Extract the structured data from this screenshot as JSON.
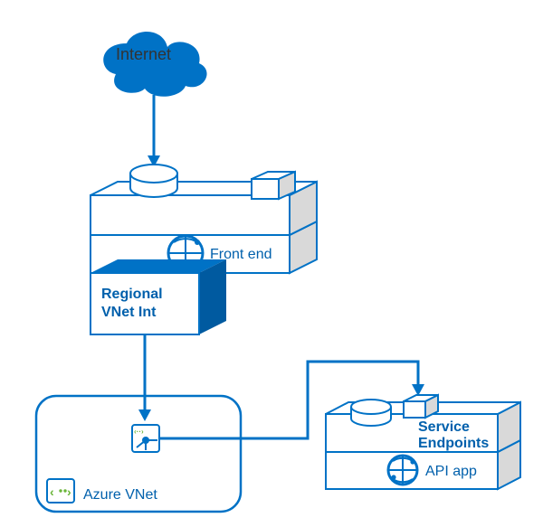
{
  "internet_label": "Internet",
  "frontend_label": "Front end",
  "regional_label_line1": "Regional",
  "regional_label_line2": "VNet Int",
  "azure_vnet_label": "Azure VNet",
  "service_endpoints_line1": "Service",
  "service_endpoints_line2": "Endpoints",
  "api_app_label": "API app",
  "colors": {
    "primary": "#0072c6",
    "primary_dark": "#005aa0",
    "text": "#0060ac",
    "gray": "#d9d9d9"
  }
}
